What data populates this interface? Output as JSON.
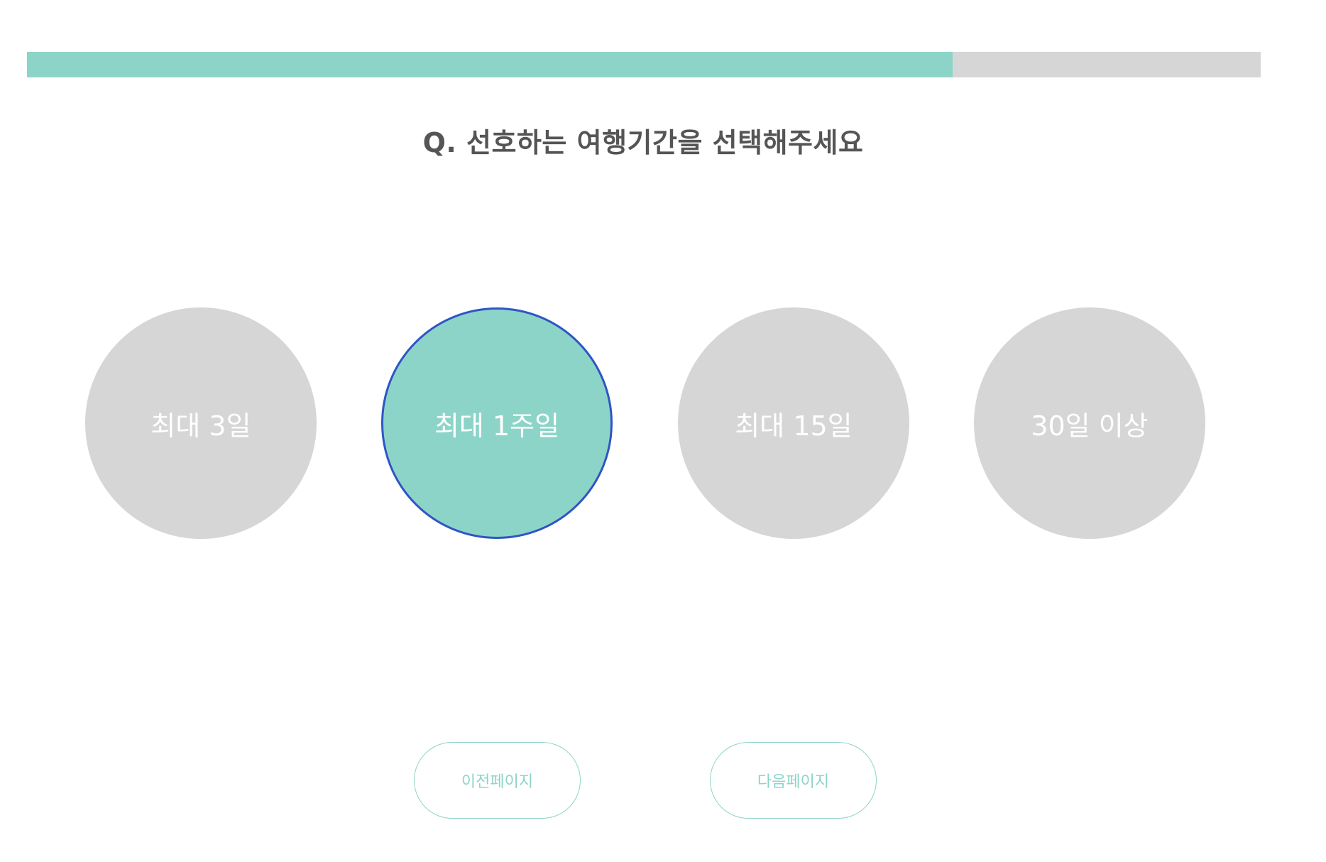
{
  "progress": {
    "fraction": 0.75,
    "fill_color": "#8dd4c8",
    "track_color": "#d6d6d6"
  },
  "question": {
    "text": "Q. 선호하는 여행기간을 선택해주세요"
  },
  "options": [
    {
      "label": "최대 3일",
      "selected": false
    },
    {
      "label": "최대 1주일",
      "selected": true
    },
    {
      "label": "최대 15일",
      "selected": false
    },
    {
      "label": "30일 이상",
      "selected": false
    }
  ],
  "navigation": {
    "prev_label": "이전페이지",
    "next_label": "다음페이지"
  },
  "colors": {
    "accent": "#8dd4c8",
    "unselected": "#d6d6d6",
    "selected_border": "#2e55c4",
    "question_text": "#555555"
  }
}
